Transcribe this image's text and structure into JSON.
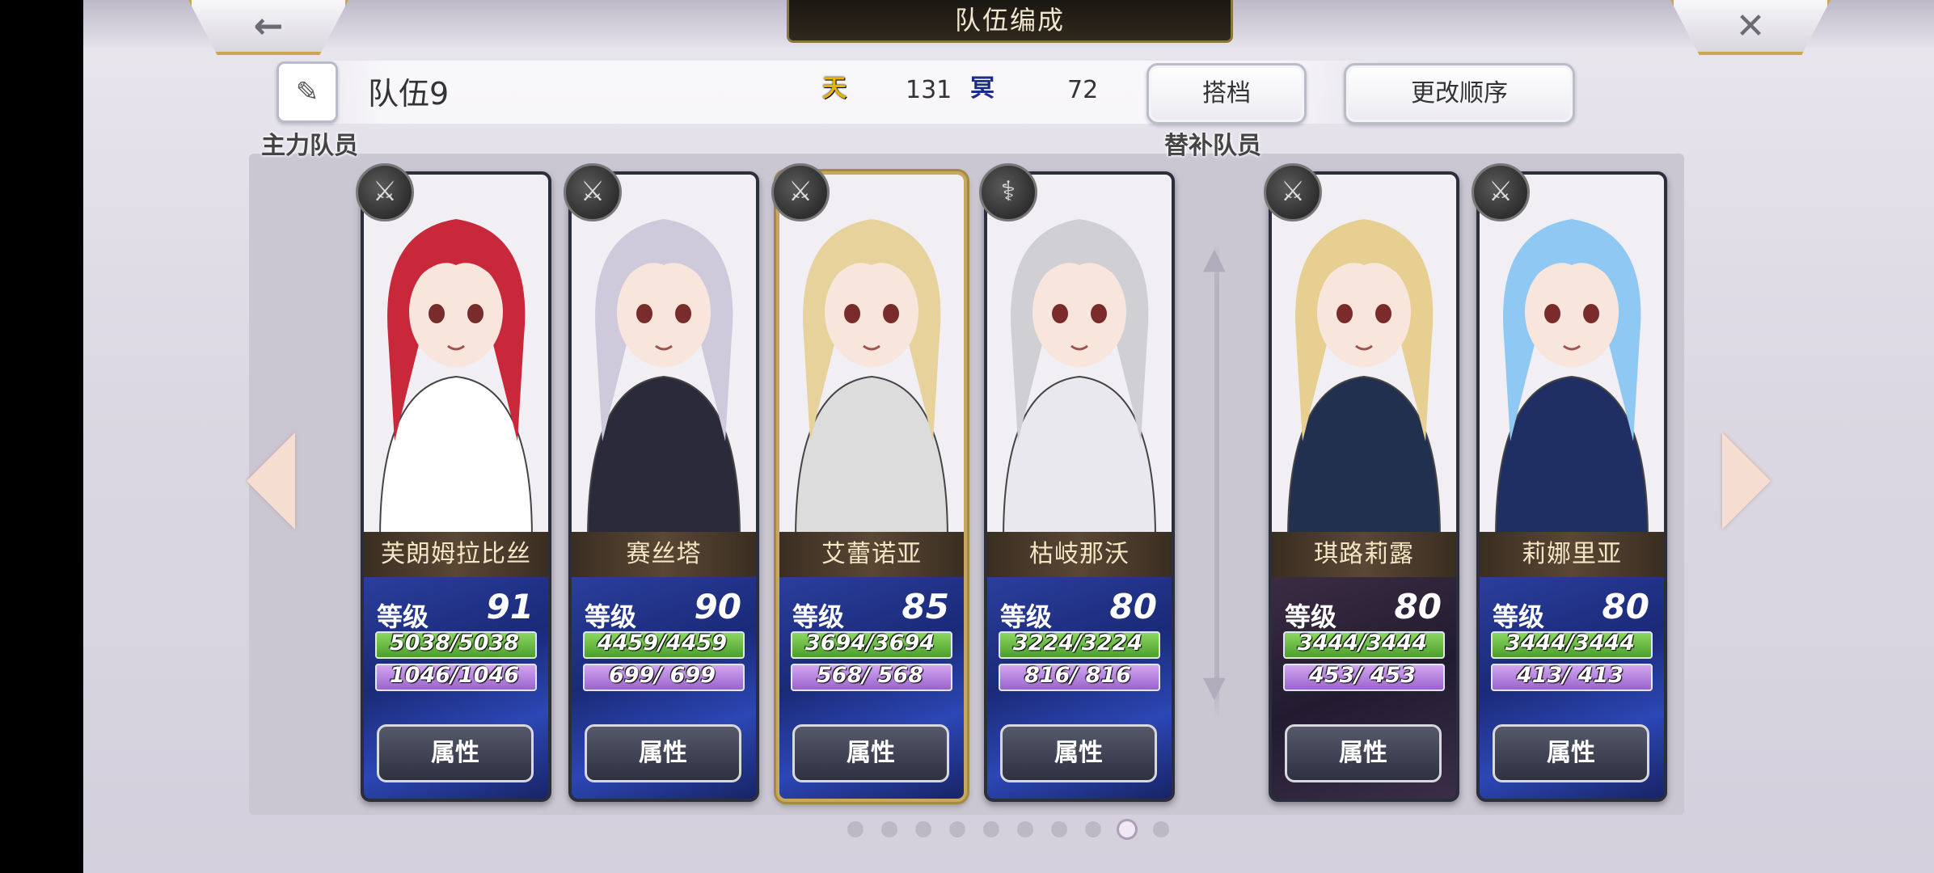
{
  "header": {
    "title": "队伍编成",
    "back_icon": "←",
    "close_icon": "✕"
  },
  "team": {
    "name": "队伍9",
    "edit_icon": "✎",
    "heaven_icon": "天",
    "heaven_value": "131",
    "nether_icon": "冥",
    "nether_value": "72",
    "partner_label": "搭档",
    "reorder_label": "更改顺序"
  },
  "sections": {
    "main_label": "主力队员",
    "sub_label": "替补队员"
  },
  "main_members": [
    {
      "name": "芙朗姆拉比丝",
      "level_label": "等级",
      "level": "91",
      "hp": "5038/5038",
      "mp": "1046/1046",
      "attr_label": "属性",
      "weapon": "sword",
      "weapon_glyph": "⚔",
      "hair": "#c9283a",
      "accent": "#ffffff"
    },
    {
      "name": "赛丝塔",
      "level_label": "等级",
      "level": "90",
      "hp": "4459/4459",
      "mp": "699/ 699",
      "attr_label": "属性",
      "weapon": "blade",
      "weapon_glyph": "⚔",
      "hair": "#cfc9dc",
      "accent": "#2a2a3a"
    },
    {
      "name": "艾蕾诺亚",
      "level_label": "等级",
      "level": "85",
      "hp": "3694/3694",
      "mp": "568/ 568",
      "attr_label": "属性",
      "weapon": "sword",
      "weapon_glyph": "⚔",
      "hair": "#e6d29a",
      "accent": "#dcdcdc"
    },
    {
      "name": "枯岐那沃",
      "level_label": "等级",
      "level": "80",
      "hp": "3224/3224",
      "mp": "816/ 816",
      "attr_label": "属性",
      "weapon": "staff",
      "weapon_glyph": "⚕",
      "hair": "#cfcfd4",
      "accent": "#e8e8ee"
    }
  ],
  "sub_members": [
    {
      "name": "琪路莉露",
      "level_label": "等级",
      "level": "80",
      "hp": "3444/3444",
      "mp": "453/ 453",
      "attr_label": "属性",
      "weapon": "sword",
      "weapon_glyph": "⚔",
      "hair": "#e7cf92",
      "accent": "#22304f"
    },
    {
      "name": "莉娜里亚",
      "level_label": "等级",
      "level": "80",
      "hp": "3444/3444",
      "mp": "413/ 413",
      "attr_label": "属性",
      "weapon": "sword",
      "weapon_glyph": "⚔",
      "hair": "#8fc8f3",
      "accent": "#1f2e63"
    }
  ],
  "pagination": {
    "total": 10,
    "current": 9
  }
}
